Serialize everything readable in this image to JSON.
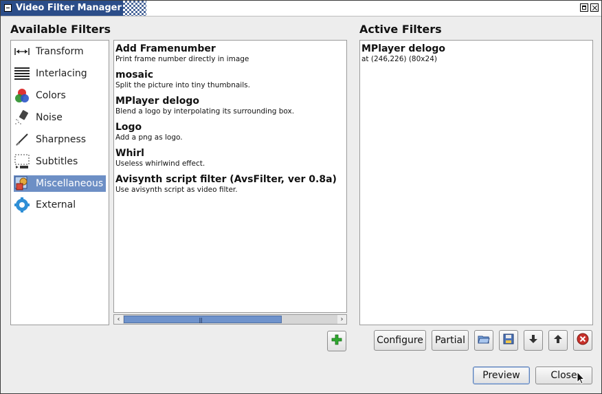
{
  "window": {
    "title": "Video Filter Manager"
  },
  "available": {
    "heading": "Available Filters",
    "categories": [
      {
        "label": "Transform",
        "icon": "transform-icon"
      },
      {
        "label": "Interlacing",
        "icon": "interlacing-icon"
      },
      {
        "label": "Colors",
        "icon": "colors-icon"
      },
      {
        "label": "Noise",
        "icon": "noise-icon"
      },
      {
        "label": "Sharpness",
        "icon": "sharpness-icon"
      },
      {
        "label": "Subtitles",
        "icon": "subtitles-icon"
      },
      {
        "label": "Miscellaneous",
        "icon": "miscellaneous-icon",
        "selected": true
      },
      {
        "label": "External",
        "icon": "external-icon"
      }
    ],
    "filters": [
      {
        "name": "Add Framenumber",
        "desc": "Print frame number directly in image"
      },
      {
        "name": "mosaic",
        "desc": "Split the picture into tiny thumbnails."
      },
      {
        "name": "MPlayer delogo",
        "desc": "Blend a logo by interpolating its surrounding box."
      },
      {
        "name": "Logo",
        "desc": "Add a png as logo."
      },
      {
        "name": "Whirl",
        "desc": "Useless whirlwind effect."
      },
      {
        "name": "Avisynth script filter (AvsFilter, ver 0.8a)",
        "desc": "Use avisynth script as video filter."
      }
    ],
    "add_icon": "add-icon"
  },
  "active": {
    "heading": "Active Filters",
    "filters": [
      {
        "name": "MPlayer delogo",
        "desc": "at (246,226) (80x24)"
      }
    ]
  },
  "toolbar": {
    "configure": "Configure",
    "partial": "Partial",
    "open_icon": "open-folder-icon",
    "save_icon": "save-icon",
    "down_icon": "arrow-down-icon",
    "up_icon": "arrow-up-icon",
    "remove_icon": "remove-icon"
  },
  "footer": {
    "preview": "Preview",
    "close": "Close"
  },
  "colors": {
    "selection": "#6d8fc5",
    "titlebar": "#2b4d89",
    "add_green": "#2fa82f",
    "remove_red": "#c8312b"
  }
}
